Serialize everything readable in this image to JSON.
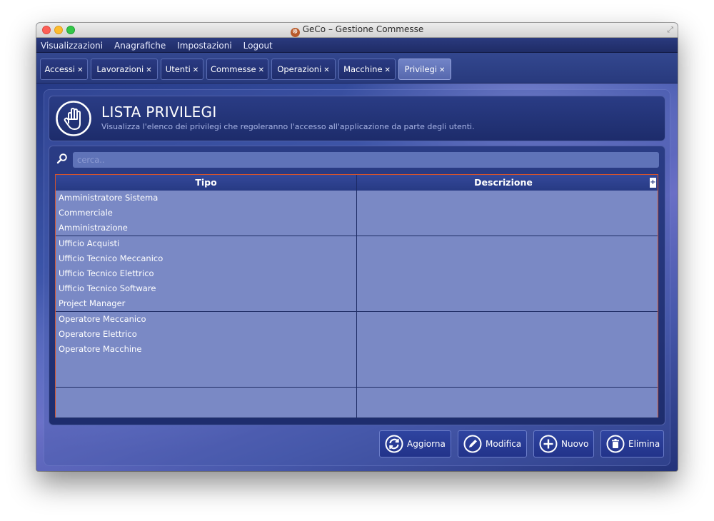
{
  "window": {
    "title": "GeCo – Gestione Commesse"
  },
  "menu": [
    "Visualizzazioni",
    "Anagrafiche",
    "Impostazioni",
    "Logout"
  ],
  "tabs": [
    {
      "label": "Accessi",
      "active": false
    },
    {
      "label": "Lavorazioni",
      "active": false
    },
    {
      "label": "Utenti",
      "active": false
    },
    {
      "label": "Commesse",
      "active": false
    },
    {
      "label": "Operazioni",
      "active": false
    },
    {
      "label": "Macchine",
      "active": false
    },
    {
      "label": "Privilegi",
      "active": true
    }
  ],
  "header": {
    "title": "LISTA PRIVILEGI",
    "subtitle": "Visualizza l'elenco dei privilegi che regoleranno l'accesso all'applicazione da parte degli utenti."
  },
  "search": {
    "placeholder": "cerca.."
  },
  "table": {
    "columns": [
      "Tipo",
      "Descrizione"
    ],
    "add_column_symbol": "+",
    "rows": [
      {
        "tipo": "Amministratore Sistema",
        "descrizione": ""
      },
      {
        "tipo": "Commerciale",
        "descrizione": ""
      },
      {
        "tipo": "Amministrazione",
        "descrizione": ""
      },
      {
        "tipo": "Ufficio Acquisti",
        "descrizione": ""
      },
      {
        "tipo": "Ufficio Tecnico Meccanico",
        "descrizione": ""
      },
      {
        "tipo": "Ufficio Tecnico Elettrico",
        "descrizione": ""
      },
      {
        "tipo": "Ufficio Tecnico Software",
        "descrizione": ""
      },
      {
        "tipo": "Project Manager",
        "descrizione": ""
      },
      {
        "tipo": "Operatore Meccanico",
        "descrizione": ""
      },
      {
        "tipo": "Operatore Elettrico",
        "descrizione": ""
      },
      {
        "tipo": "Operatore Macchine",
        "descrizione": ""
      },
      {
        "tipo": "",
        "descrizione": ""
      },
      {
        "tipo": "",
        "descrizione": ""
      },
      {
        "tipo": "",
        "descrizione": ""
      },
      {
        "tipo": "",
        "descrizione": ""
      }
    ]
  },
  "actions": [
    {
      "label": "Aggiorna",
      "icon": "refresh-icon"
    },
    {
      "label": "Modifica",
      "icon": "pencil-icon"
    },
    {
      "label": "Nuovo",
      "icon": "plus-circle-icon"
    },
    {
      "label": "Elimina",
      "icon": "trash-icon"
    }
  ],
  "colors": {
    "accent": "#d2532e",
    "panel": "#1d2c6b",
    "row": "#7a89c5",
    "active_tab": "#6677bb"
  }
}
